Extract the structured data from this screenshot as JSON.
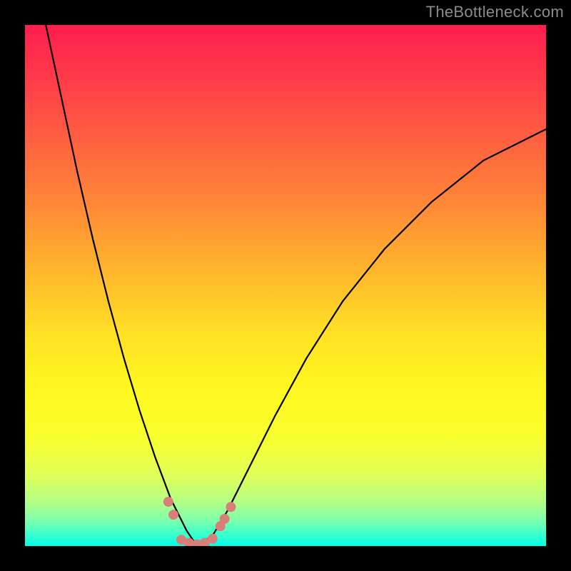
{
  "watermark": "TheBottleneck.com",
  "chart_data": {
    "type": "line",
    "title": "",
    "xlabel": "",
    "ylabel": "",
    "xlim": [
      0,
      100
    ],
    "ylim": [
      0,
      100
    ],
    "note": "Gradient background from red (top, ~100) through orange/yellow to cyan-green (bottom, ~0). Black V-shaped curve with minimum near x≈33, plus salmon dotted segments near minimum.",
    "series": [
      {
        "name": "curve",
        "x": [
          4,
          7,
          10,
          13,
          16,
          19,
          22,
          25,
          28,
          31,
          33,
          36,
          39,
          43,
          48,
          54,
          61,
          69,
          78,
          88,
          100
        ],
        "y": [
          100,
          86,
          72,
          59,
          47,
          36,
          26,
          17,
          9,
          3,
          0,
          2,
          7,
          15,
          25,
          36,
          47,
          57,
          66,
          74,
          80
        ],
        "color": "#000000"
      },
      {
        "name": "marker-left",
        "x": [
          27.5,
          28.5
        ],
        "y": [
          8.5,
          6.0
        ],
        "color": "#d97f7a"
      },
      {
        "name": "marker-bottom",
        "x": [
          30,
          31.5,
          33,
          34.5,
          36
        ],
        "y": [
          1.2,
          0.6,
          0.3,
          0.6,
          1.4
        ],
        "color": "#d97f7a"
      },
      {
        "name": "marker-right",
        "x": [
          37.5,
          38.3,
          39.5
        ],
        "y": [
          3.8,
          5.2,
          7.5
        ],
        "color": "#d97f7a"
      }
    ]
  }
}
